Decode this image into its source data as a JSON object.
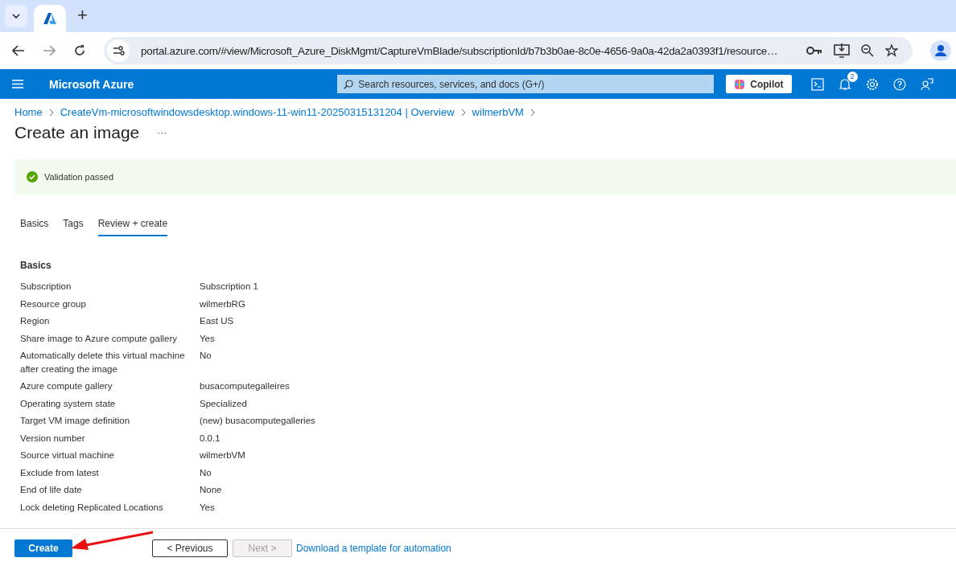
{
  "browser": {
    "tab_strip": {
      "new_tab": "+"
    },
    "address": "portal.azure.com/#view/Microsoft_Azure_DiskMgmt/CaptureVmBlade/subscriptionId/b7b3b0ae-8c0e-4656-9a0a-42da2a0393f1/resource…"
  },
  "header": {
    "brand": "Microsoft Azure",
    "search": {
      "placeholder": "Search resources, services, and docs (G+/)"
    },
    "copilot": "Copilot",
    "notification_count": "2"
  },
  "breadcrumb": [
    "Home",
    "CreateVm-microsoftwindowsdesktop.windows-11-win11-20250315131204 | Overview",
    "wilmerbVM"
  ],
  "page_title": "Create an image",
  "more": "···",
  "banner": {
    "text": "Validation passed"
  },
  "tabs": [
    {
      "label": "Basics",
      "selected": false
    },
    {
      "label": "Tags",
      "selected": false
    },
    {
      "label": "Review + create",
      "selected": true
    }
  ],
  "section": {
    "title": "Basics",
    "rows": [
      {
        "label": "Subscription",
        "value": "Subscription 1"
      },
      {
        "label": "Resource group",
        "value": "wilmerbRG"
      },
      {
        "label": "Region",
        "value": "East US"
      },
      {
        "label": "Share image to Azure compute gallery",
        "value": "Yes"
      },
      {
        "label": "Automatically delete this virtual machine after creating the image",
        "value": "No"
      },
      {
        "label": "Azure compute gallery",
        "value": "busacomputegalleires"
      },
      {
        "label": "Operating system state",
        "value": "Specialized"
      },
      {
        "label": "Target VM image definition",
        "value": "(new) busacomputegalleries"
      },
      {
        "label": "Version number",
        "value": "0.0.1"
      },
      {
        "label": "Source virtual machine",
        "value": "wilmerbVM"
      },
      {
        "label": "Exclude from latest",
        "value": "No"
      },
      {
        "label": "End of life date",
        "value": "None"
      },
      {
        "label": "Lock deleting Replicated Locations",
        "value": "Yes"
      }
    ]
  },
  "footer": {
    "buttons": [
      {
        "label": "Create",
        "kind": "primary",
        "disabled": false
      },
      {
        "label": "< Previous",
        "kind": "secondary",
        "disabled": false
      },
      {
        "label": "Next >",
        "kind": "secondary",
        "disabled": true
      }
    ],
    "link": "Download a template for automation"
  }
}
